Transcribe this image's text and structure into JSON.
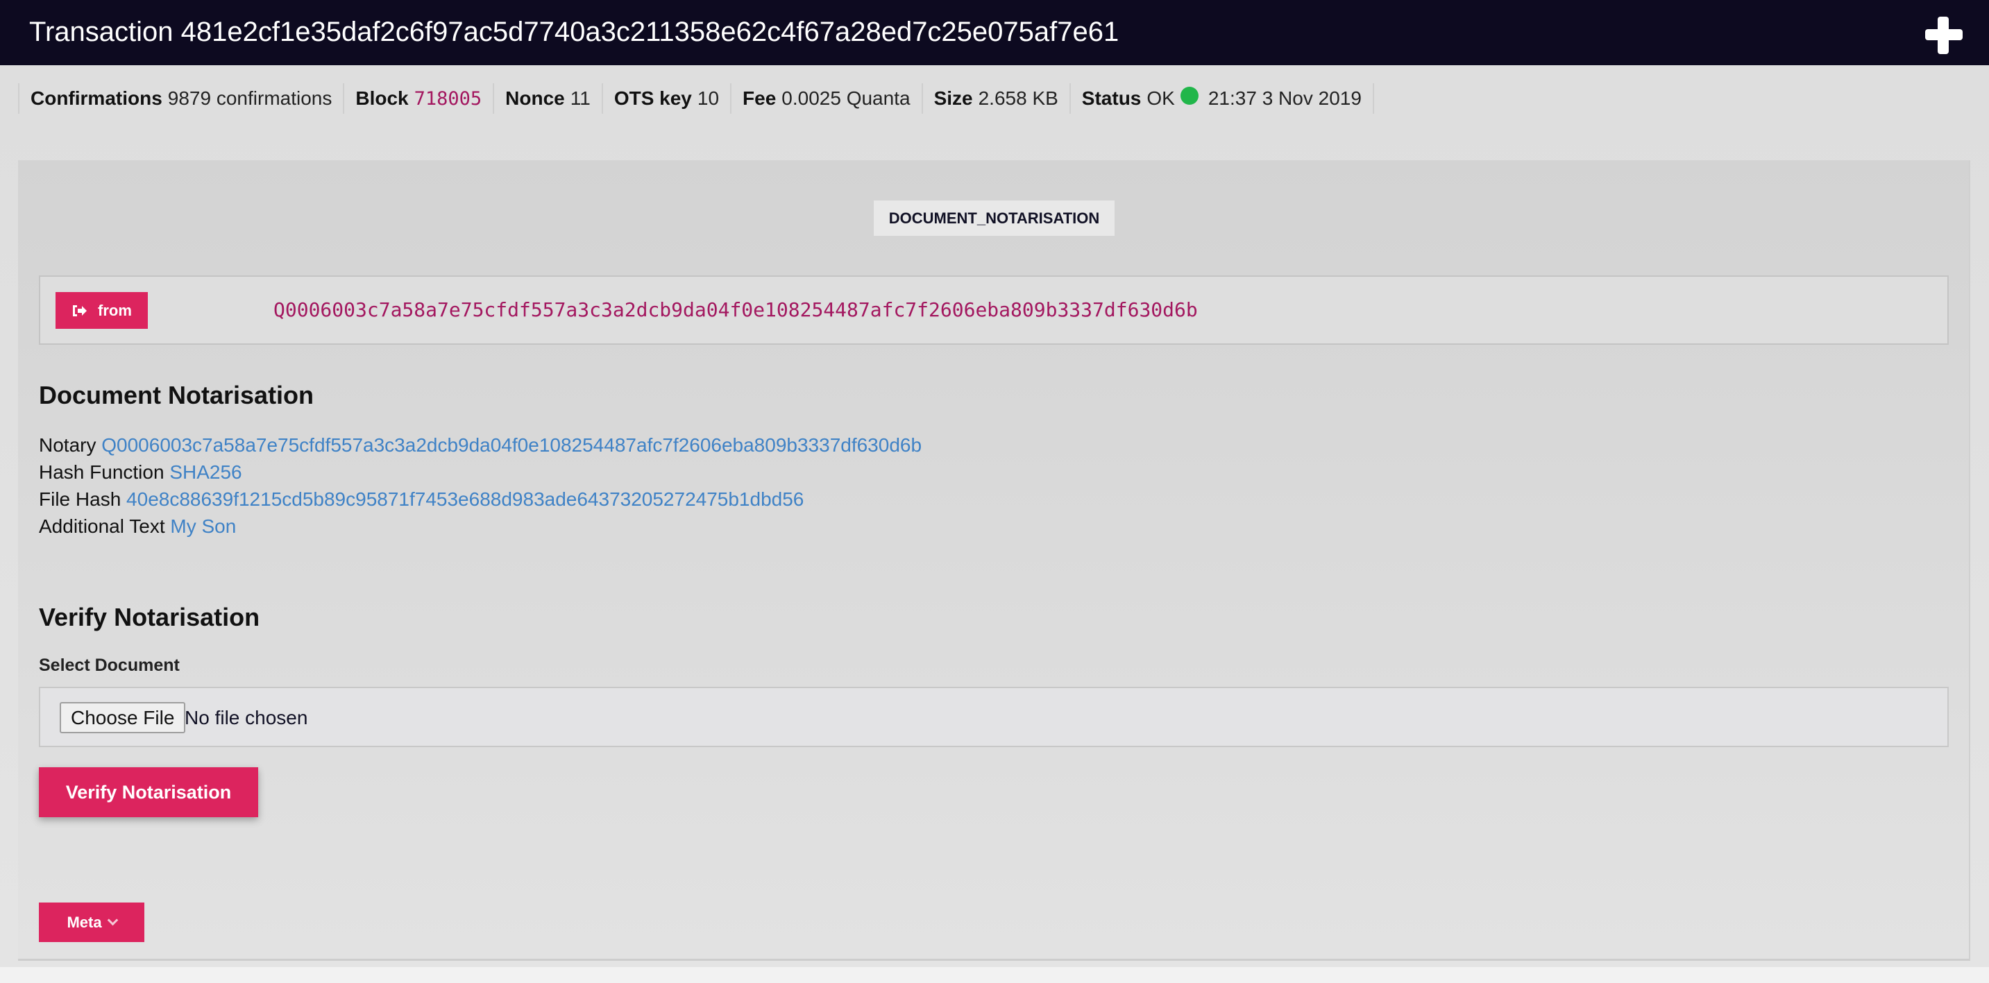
{
  "header": {
    "title": "Transaction 481e2cf1e35daf2c6f97ac5d7740a3c211358e62c4f67a28ed7c25e075af7e61",
    "action_icon": "plus-icon"
  },
  "meta": {
    "confirmations_label": "Confirmations",
    "confirmations_value": "9879 confirmations",
    "block_label": "Block",
    "block_value": "718005",
    "nonce_label": "Nonce",
    "nonce_value": "11",
    "ots_label": "OTS key",
    "ots_value": "10",
    "fee_label": "Fee",
    "fee_value": "0.0025 Quanta",
    "size_label": "Size",
    "size_value": "2.658 KB",
    "status_label": "Status",
    "status_value": "OK",
    "status_color": "#21b64a",
    "timestamp": "21:37 3 Nov 2019"
  },
  "transaction": {
    "type": "DOCUMENT_NOTARISATION",
    "from_label": "from",
    "from_icon": "sign-out-icon",
    "from_address": "Q0006003c7a58a7e75cfdf557a3c3a2dcb9da04f0e108254487afc7f2606eba809b3337df630d6b"
  },
  "notarisation": {
    "heading": "Document Notarisation",
    "fields": [
      {
        "label": "Notary",
        "value": "Q0006003c7a58a7e75cfdf557a3c3a2dcb9da04f0e108254487afc7f2606eba809b3337df630d6b"
      },
      {
        "label": "Hash Function",
        "value": "SHA256"
      },
      {
        "label": "File Hash",
        "value": "40e8c88639f1215cd5b89c95871f7453e688d983ade64373205272475b1dbd56"
      },
      {
        "label": "Additional Text",
        "value": "My Son"
      }
    ]
  },
  "verify": {
    "heading": "Verify Notarisation",
    "select_label": "Select Document",
    "choose_file_label": "Choose File",
    "file_status": "No file chosen",
    "button_label": "Verify Notarisation"
  },
  "meta_toggle": {
    "label": "Meta",
    "icon": "chevron-down-icon"
  },
  "colors": {
    "header_bg": "#0d0a20",
    "accent": "#dc245e",
    "address": "#a3175f",
    "link": "#3f82c6"
  }
}
